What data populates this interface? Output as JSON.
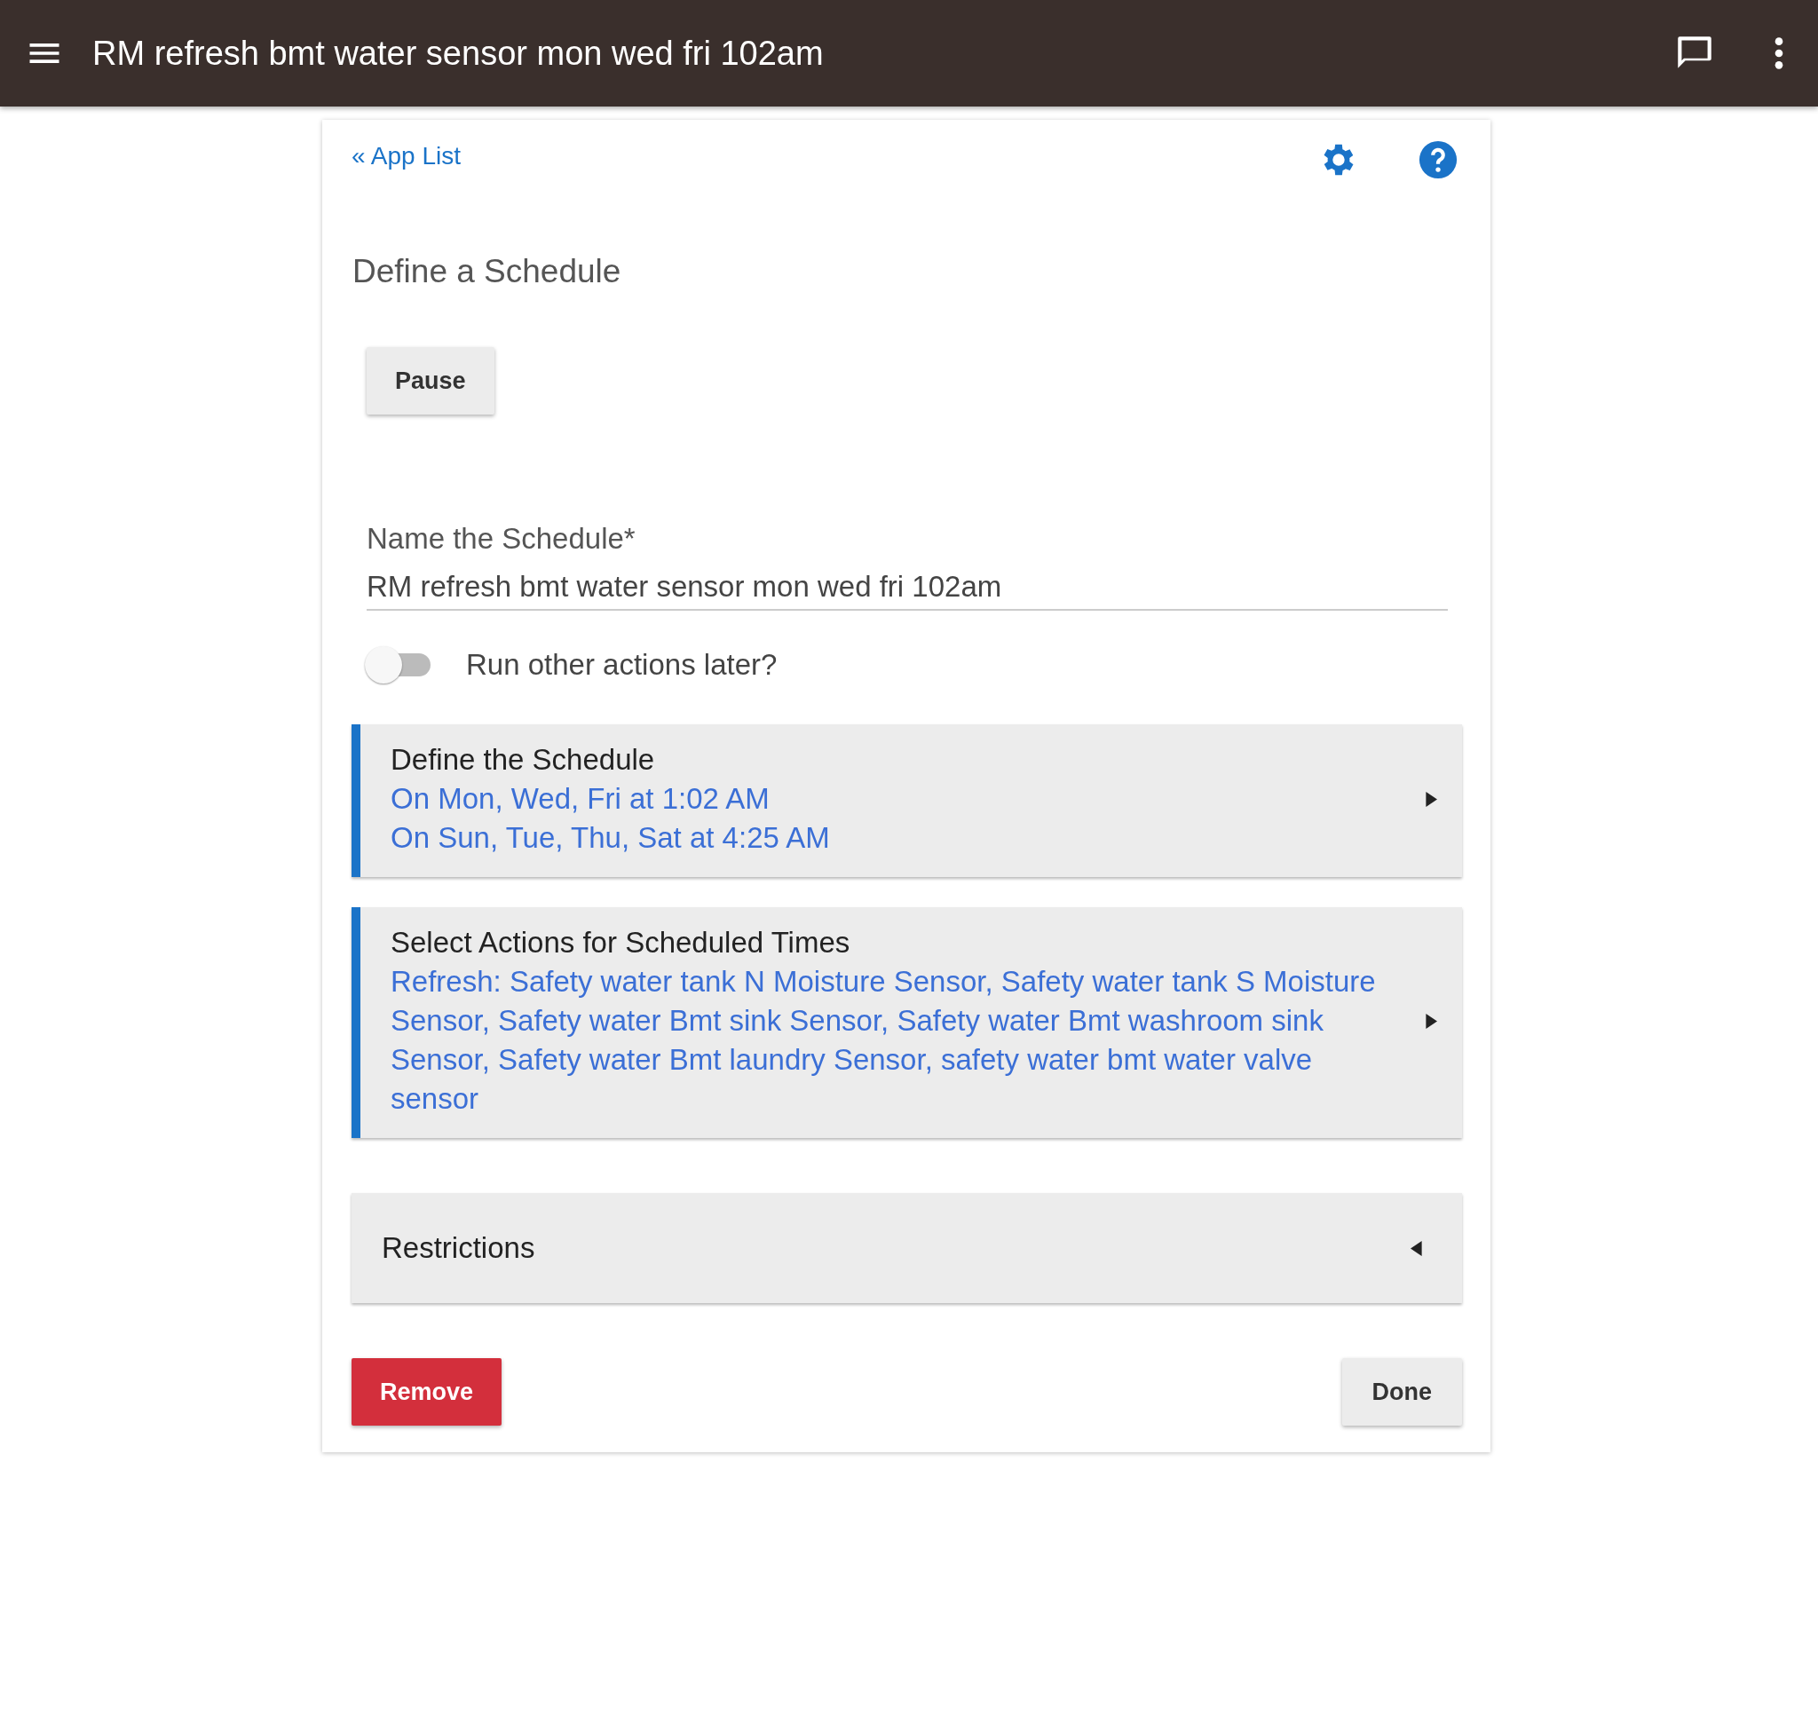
{
  "header": {
    "title": "RM refresh bmt water sensor mon wed fri 102am"
  },
  "back_link": "« App List",
  "page_title": "Define a Schedule",
  "pause_button": "Pause",
  "name_field": {
    "label": "Name the Schedule*",
    "value": "RM refresh bmt water sensor mon wed fri 102am"
  },
  "toggle": {
    "label": "Run other actions later?",
    "on": false
  },
  "sections": [
    {
      "kind": "link",
      "title": "Define the Schedule",
      "lines": [
        "On Mon, Wed, Fri at 1:02 AM",
        "On Sun, Tue, Thu, Sat at 4:25 AM"
      ]
    },
    {
      "kind": "link",
      "title": "Select Actions for Scheduled Times",
      "lines": [
        "Refresh: Safety water tank N Moisture Sensor, Safety water tank S Moisture Sensor, Safety water Bmt sink Sensor, Safety water Bmt washroom sink Sensor, Safety water Bmt laundry Sensor, safety water bmt water valve sensor"
      ]
    },
    {
      "kind": "collapsible",
      "title": "Restrictions",
      "expanded": false
    }
  ],
  "buttons": {
    "remove": "Remove",
    "done": "Done"
  }
}
